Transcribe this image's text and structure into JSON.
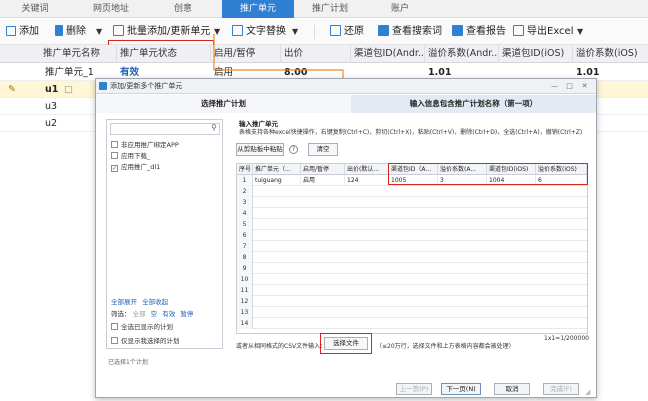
{
  "tabs": [
    {
      "label": "关键词",
      "active": false
    },
    {
      "label": "网页地址",
      "active": false
    },
    {
      "label": "创意",
      "active": false
    },
    {
      "label": "推广单元",
      "active": true
    },
    {
      "label": "推广计划",
      "active": false
    },
    {
      "label": "账户",
      "active": false
    }
  ],
  "toolbar": {
    "add": "添加",
    "delete": "删除",
    "batch": "批量添加/更新单元",
    "text_replace": "文字替换",
    "restore": "还原",
    "view_search": "查看搜索词",
    "view_report": "查看报告",
    "export": "导出Excel"
  },
  "grid": {
    "headers": [
      "推广单元名称",
      "推广单元状态",
      "启用/暂停",
      "出价",
      "渠道包ID(Andr...",
      "溢价系数(Andr...",
      "渠道包ID(iOS)",
      "溢价系数(iOS)"
    ],
    "rows": [
      {
        "name": "推广单元_1",
        "status": "有效",
        "enabled": "启用",
        "bid": "8.00",
        "ch_and": "",
        "coef_and": "1.01",
        "ch_ios": "",
        "coef_ios": "1.01"
      },
      {
        "name": "u1",
        "status": "",
        "enabled": "",
        "bid": "",
        "ch_and": "",
        "coef_and": "",
        "ch_ios": "",
        "coef_ios": ""
      },
      {
        "name": "u3",
        "status": "",
        "enabled": "",
        "bid": "",
        "ch_and": "",
        "coef_and": "",
        "ch_ios": "",
        "coef_ios": ""
      },
      {
        "name": "u2",
        "status": "",
        "enabled": "",
        "bid": "",
        "ch_and": "",
        "coef_and": "",
        "ch_ios": "",
        "coef_ios": ""
      }
    ]
  },
  "dialog": {
    "title": "添加/更新多个推广单元",
    "step1": "选择推广计划",
    "step2": "输入信息包含推广计划名称（第一项）",
    "plan_items": [
      {
        "label": "非应用推广绑定APP",
        "checked": false
      },
      {
        "label": "应用下载_",
        "checked": false
      },
      {
        "label": "应用推广_dl1",
        "checked": true
      }
    ],
    "expand_all": "全部展开",
    "collapse_all": "全部收起",
    "filter_label": "筛选：",
    "filter_all": "全部",
    "filter_empty": "空",
    "filter_valid": "有效",
    "filter_paused": "暂停",
    "check_all_shown": "全选已显示的计划",
    "only_selected": "仅显示我选择的计划",
    "selected_count": "已选择1个计划",
    "input_title": "输入推广单元",
    "hint": "表格支持各种excel快捷操作，右键复制(Ctrl+C)，剪切(Ctrl+X)，粘贴(Ctrl+V)，删除(Ctrl+D)，全选(Ctrl+A)，撤销(Ctrl+Z)",
    "paste_btn": "从剪贴板中粘贴",
    "help_icon_text": "?",
    "clear_btn": "清空",
    "table_headers": [
      "序号",
      "推广单元（...",
      "启用/暂停",
      "出价(默认...",
      "渠道包ID（A...",
      "溢价系数(A...",
      "渠道包ID(iOS)",
      "溢价系数(iOS)"
    ],
    "table_rows": [
      {
        "n": "1",
        "unit": "tuiguang",
        "enabled": "启用",
        "bid": "124",
        "ch_a": "1005",
        "coef_a": "3",
        "ch_ios": "1004",
        "coef_ios": "6"
      },
      {
        "n": "2"
      },
      {
        "n": "3"
      },
      {
        "n": "4"
      },
      {
        "n": "5"
      },
      {
        "n": "6"
      },
      {
        "n": "7"
      },
      {
        "n": "8"
      },
      {
        "n": "9"
      },
      {
        "n": "10"
      },
      {
        "n": "11"
      },
      {
        "n": "12"
      },
      {
        "n": "13"
      },
      {
        "n": "14"
      }
    ],
    "csv_label": "或者从相同格式的CSV文件输入：",
    "choose_file": "选择文件",
    "csv_note": "（≤20万行，选择文件和上方表格内容都会被处理）",
    "position": "1x1=1/200000",
    "prev": "上一页(P)",
    "next": "下一页(N)",
    "cancel": "取消",
    "finish": "完成(F)"
  }
}
